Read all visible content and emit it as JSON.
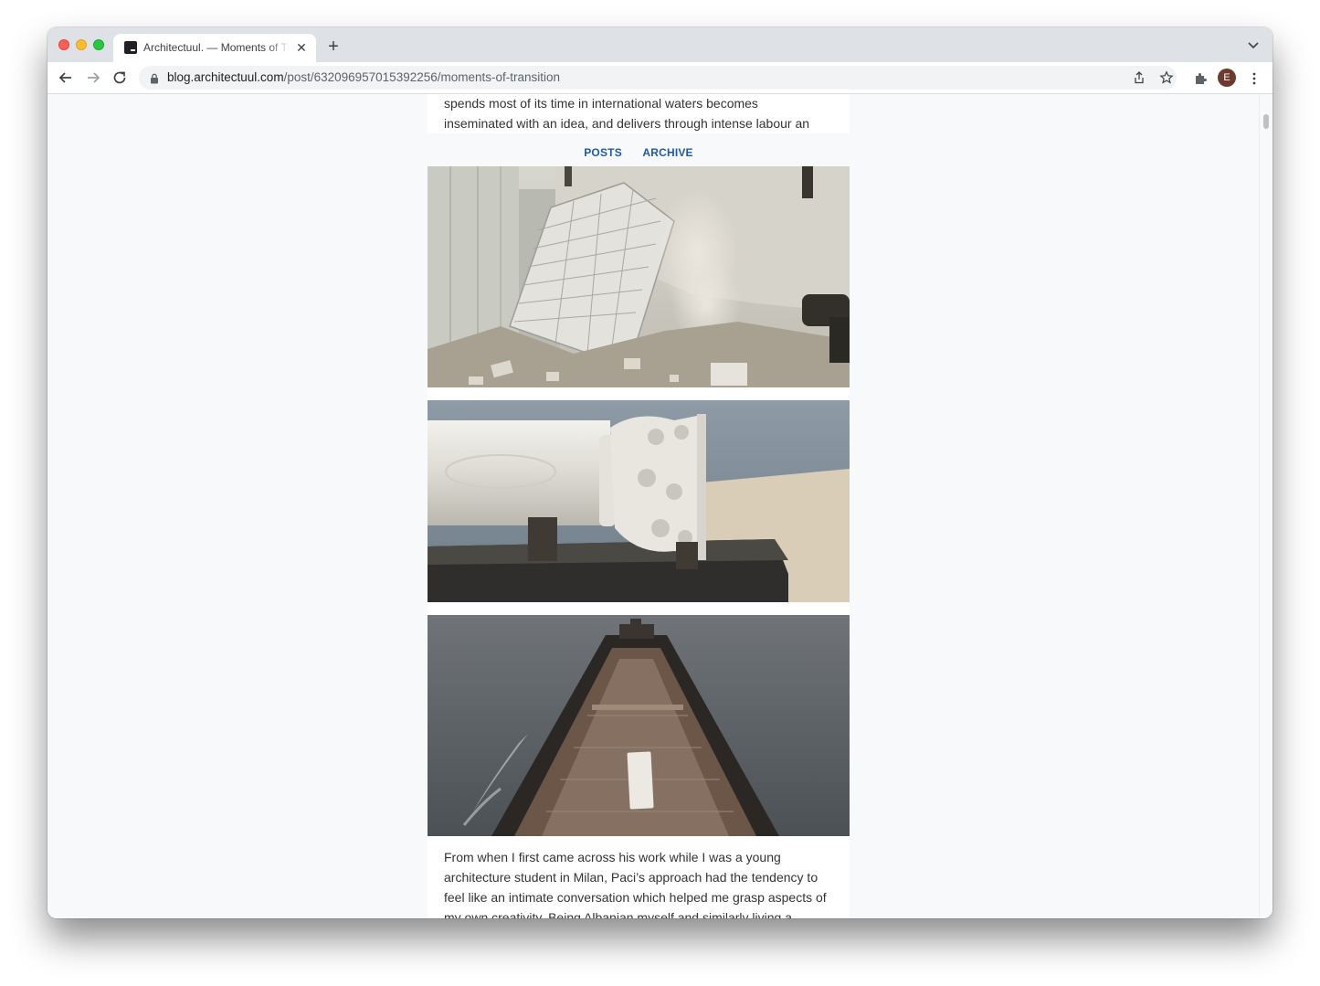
{
  "tab": {
    "title": "Architectuul. — Moments of Transition"
  },
  "address_bar": {
    "host": "blog.architectuul.com",
    "path": "/post/632096957015392256/moments-of-transition"
  },
  "profile": {
    "initial": "E",
    "color": "#6d3b2e"
  },
  "article": {
    "intro_lines": [
      "spends most of its time in international waters becomes",
      "inseminated with an idea, and delivers through intense labour an"
    ],
    "nav": {
      "posts": "POSTS",
      "archive": "ARCHIVE"
    },
    "photos": [
      {
        "subject": "marble block quarry"
      },
      {
        "subject": "marble column capital"
      },
      {
        "subject": "cargo ship with marble block"
      }
    ],
    "body_lines": [
      "From when I first came across his work while I was a young",
      "architecture student in Milan, Paci’s approach had the tendency to",
      "feel like an intimate conversation which helped me grasp aspects of",
      "my own creativity. Being Albanian myself and similarly living a"
    ]
  },
  "colors": {
    "nav_link": "#1f5aa6",
    "page_bg": "#f8f9fa"
  }
}
